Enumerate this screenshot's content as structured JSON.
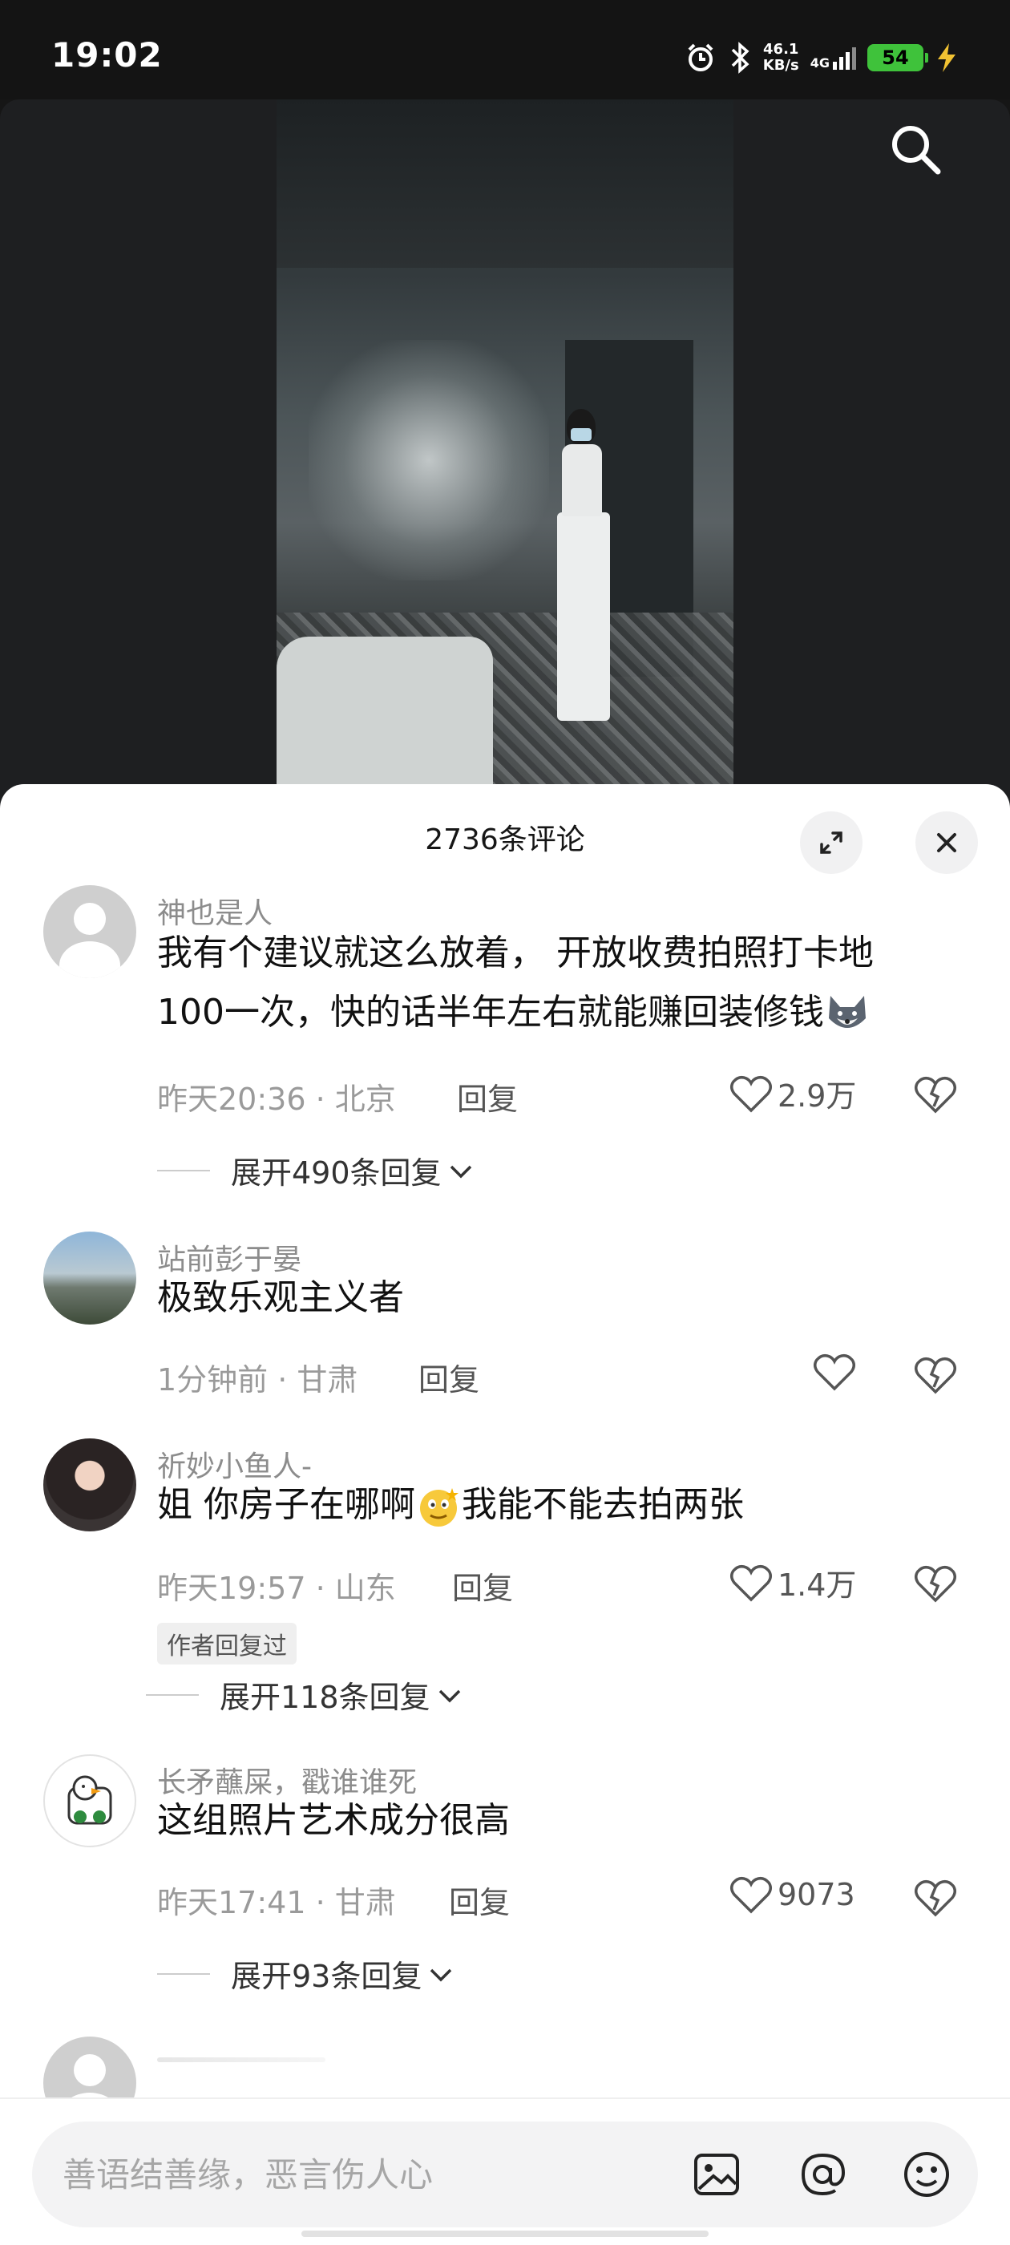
{
  "status_bar": {
    "time": "19:02",
    "net_speed_value": "46.1",
    "net_speed_unit": "KB/s",
    "network_type": "4G",
    "battery_level": "54"
  },
  "comments_sheet": {
    "title": "2736条评论",
    "input_placeholder": "善语结善缘，恶言伤人心",
    "comments": [
      {
        "username": "神也是人",
        "text_line1": "我有个建议就这么放着， 开放收费拍照打卡地",
        "text_line2": "100一次，快的话半年左右就能赚回装修钱",
        "time_location": "昨天20:36 · 北京",
        "reply_label": "回复",
        "likes": "2.9万",
        "expand_label": "展开490条回复"
      },
      {
        "username": "站前彭于晏",
        "text": "极致乐观主义者",
        "time_location": "1分钟前 · 甘肃",
        "reply_label": "回复",
        "likes": ""
      },
      {
        "username": "祈妙小鱼人-",
        "text_before_emoji": "姐 你房子在哪啊",
        "text_after_emoji": "我能不能去拍两张",
        "time_location": "昨天19:57 · 山东",
        "reply_label": "回复",
        "likes": "1.4万",
        "author_badge": "作者回复过",
        "expand_label": "展开118条回复"
      },
      {
        "username": "长矛蘸屎，戳谁谁死",
        "text": "这组照片艺术成分很高",
        "time_location": "昨天17:41 · 甘肃",
        "reply_label": "回复",
        "likes": "9073",
        "expand_label": "展开93条回复"
      }
    ]
  }
}
